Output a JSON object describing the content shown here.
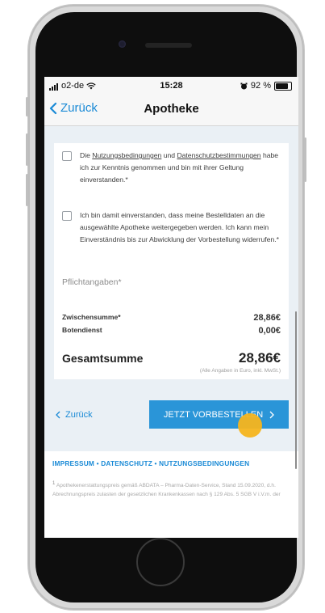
{
  "status_bar": {
    "carrier": "o2-de",
    "time": "15:28",
    "battery_text": "92 %",
    "battery_level": 0.92
  },
  "nav": {
    "back_label": "Zurück",
    "title": "Apotheke"
  },
  "consents": {
    "terms": {
      "prefix": "Die ",
      "link1": "Nutzungsbedingungen",
      "mid": " und ",
      "link2": "Datenschutzbestimmungen",
      "suffix": " habe ich zur Kenntnis genommen und bin mit ihrer Geltung einverstanden.*",
      "checked": false
    },
    "data_sharing": {
      "text": "Ich bin damit einverstanden, dass meine Bestelldaten an die ausgewählte Apotheke weitergegeben werden. Ich kann mein Einverständnis bis zur Abwicklung der Vorbestellung widerrufen.*",
      "checked": false
    },
    "required_hint": "Pflichtangaben*"
  },
  "summary": {
    "subtotal_label": "Zwischensumme*",
    "subtotal_value": "28,86€",
    "delivery_label": "Botendienst",
    "delivery_value": "0,00€",
    "total_label": "Gesamtsumme",
    "total_value": "28,86€",
    "note": "(Alle Angaben in Euro, inkl. MwSt.)"
  },
  "actions": {
    "back_label": "Zurück",
    "order_label": "JETZT VORBESTELLEN"
  },
  "footer": {
    "links": [
      "IMPRESSUM",
      "DATENSCHUTZ",
      "NUTZUNGSBEDINGUNGEN"
    ],
    "footnote_mark": "1",
    "footnote_text": "Apothekenerstattungspreis gemäß ABDATA – Pharma-Daten-Service, Stand 15.09.2020, d.h. Abrechnungspreis zulasten der gesetzlichen Krankenkassen nach § 129 Abs. 5 SGB V i.V.m. der"
  },
  "colors": {
    "accent": "#1a8ad6",
    "button": "#2a95d8",
    "tap_marker": "#f5b41d"
  }
}
